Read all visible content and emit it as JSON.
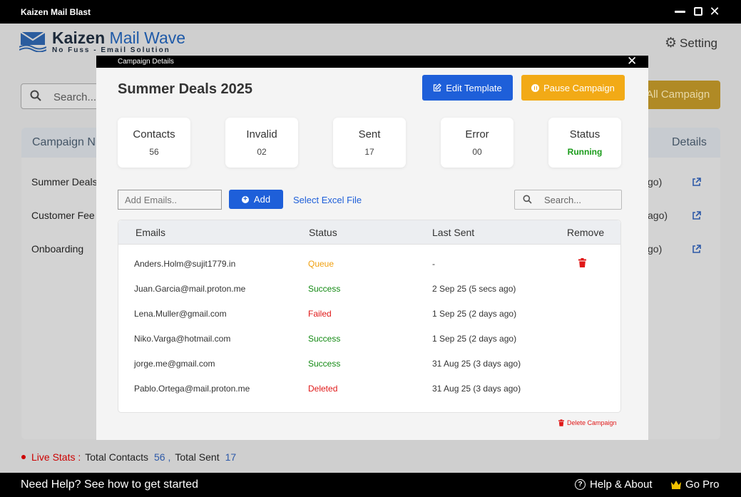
{
  "window": {
    "title": "Kaizen Mail Blast"
  },
  "app": {
    "brand_name_1": "Kaizen",
    "brand_name_2": "Mail Wave",
    "tagline": "No Fuss - Email Solution",
    "setting_label": "Setting",
    "search_placeholder": "Search...",
    "all_campaign_label": "All Campaign",
    "table_headers": {
      "campaign_name": "Campaign N",
      "details": "Details"
    },
    "rows": [
      {
        "name": "Summer Deals",
        "ago": "go)"
      },
      {
        "name": "Customer Fee",
        "ago": "ago)"
      },
      {
        "name": "Onboarding",
        "ago": "go)"
      }
    ],
    "live_stats": {
      "label": "Live Stats :",
      "total_contacts_label": "Total Contacts",
      "total_contacts_value": "56 ,",
      "total_sent_label": "Total Sent",
      "total_sent_value": "17"
    }
  },
  "footer": {
    "help_text": "Need Help? See how to get started",
    "help_about": "Help & About",
    "go_pro": "Go Pro"
  },
  "modal": {
    "header": "Campaign Details",
    "title": "Summer Deals 2025",
    "edit_template": "Edit Template",
    "pause_campaign": "Pause Campaign",
    "stats": [
      {
        "label": "Contacts",
        "value": "56"
      },
      {
        "label": "Invalid",
        "value": "02"
      },
      {
        "label": "Sent",
        "value": "17"
      },
      {
        "label": "Error",
        "value": "00"
      },
      {
        "label": "Status",
        "value": "Running"
      }
    ],
    "add_emails_placeholder": "Add Emails..",
    "add_label": "Add",
    "select_excel": "Select Excel File",
    "search_placeholder": "Search...",
    "columns": {
      "emails": "Emails",
      "status": "Status",
      "last_sent": "Last Sent",
      "remove": "Remove"
    },
    "rows": [
      {
        "email": "Anders.Holm@sujit1779.in",
        "status": "Queue",
        "last_sent": "-"
      },
      {
        "email": "Juan.Garcia@mail.proton.me",
        "status": "Success",
        "last_sent": "2 Sep 25 (5 secs ago)"
      },
      {
        "email": "Lena.Muller@gmail.com",
        "status": "Failed",
        "last_sent": "1 Sep 25 (2 days ago)"
      },
      {
        "email": "Niko.Varga@hotmail.com",
        "status": "Success",
        "last_sent": "1 Sep 25 (2 days ago)"
      },
      {
        "email": "jorge.me@gmail.com",
        "status": "Success",
        "last_sent": "31 Aug 25 (3 days ago)"
      },
      {
        "email": "Pablo.Ortega@mail.proton.me",
        "status": "Deleted",
        "last_sent": "31 Aug 25 (3 days ago)"
      }
    ],
    "delete_campaign": "Delete Campaign"
  },
  "colors": {
    "primary_blue": "#1e5fd9",
    "accent_yellow": "#f2aa16",
    "success": "#138a13",
    "error": "#e01818",
    "queue": "#f0a010"
  }
}
